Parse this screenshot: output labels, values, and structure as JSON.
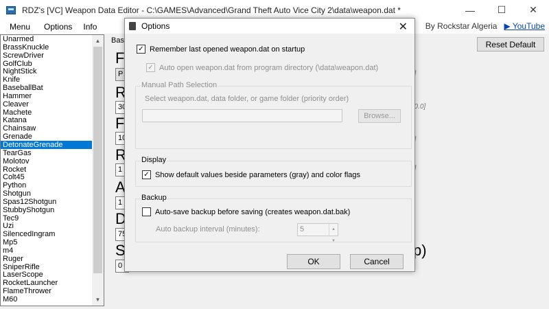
{
  "window": {
    "title": "RDZ's [VC] Weapon Data Editor - C:\\GAMES\\Advanced\\Grand Theft Auto Vice City 2\\data\\weapon.dat *",
    "minimize_glyph": "—",
    "maximize_glyph": "☐",
    "close_glyph": "✕"
  },
  "menu": {
    "items": [
      "Menu",
      "Options",
      "Info"
    ],
    "credit": "By Rockstar Algeria",
    "youtube": "▶ YouTube"
  },
  "weapon_list": {
    "items": [
      "Unarmed",
      "BrassKnuckle",
      "ScrewDriver",
      "GolfClub",
      "NightStick",
      "Knife",
      "BaseballBat",
      "Hammer",
      "Cleaver",
      "Machete",
      "Katana",
      "Chainsaw",
      "Grenade",
      "DetonateGrenade",
      "TearGas",
      "Molotov",
      "Rocket",
      "Colt45",
      "Python",
      "Shotgun",
      "Spas12Shotgun",
      "StubbyShotgun",
      "Tec9",
      "Uzi",
      "SilencedIngram",
      "Mp5",
      "m4",
      "Ruger",
      "SniperRifle",
      "LaserScope",
      "RocketLauncher",
      "FlameThrower",
      "M60"
    ],
    "selected_index": 13,
    "scroll_up": "▲",
    "scroll_down": "▼"
  },
  "panel": {
    "tab_stub": "Basi",
    "reset_label": "Reset Default",
    "big_letters": [
      "F",
      "R",
      "F",
      "R",
      "A",
      "D",
      "S"
    ],
    "box_values": [
      "P",
      "30",
      "10",
      "1",
      "1",
      "75",
      "0"
    ],
    "hints": [
      "0]",
      "00.0]",
      "0]",
      "0]"
    ],
    "big_right": "p)"
  },
  "dialog": {
    "title": "Options",
    "close_glyph": "✕",
    "remember_label": "Remember last opened weapon.dat on startup",
    "remember_checked": true,
    "auto_open_label": "Auto open weapon.dat from program directory (\\data\\weapon.dat)",
    "auto_open_checked": true,
    "manual_group_title": "Manual Path Selection",
    "manual_hint": "Select weapon.dat, data folder, or game folder (priority order)",
    "path_value": "",
    "browse_label": "Browse...",
    "display_group_title": "Display",
    "show_defaults_label": "Show default values beside parameters (gray) and color flags",
    "show_defaults_checked": true,
    "backup_group_title": "Backup",
    "autosave_label": "Auto-save backup before saving (creates weapon.dat.bak)",
    "autosave_checked": false,
    "interval_label": "Auto backup interval (minutes):",
    "interval_value": "5",
    "ok_label": "OK",
    "cancel_label": "Cancel",
    "check_glyph": "✓"
  }
}
